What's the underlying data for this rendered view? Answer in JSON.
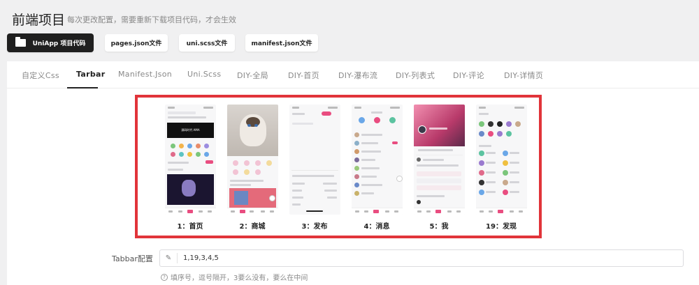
{
  "header": {
    "title": "前端项目",
    "subtitle": "每次更改配置，需要重新下载项目代码，才会生效"
  },
  "toolbar": {
    "buttons": [
      {
        "label": "UniApp 项目代码",
        "icon": "folder-icon",
        "style": "primary"
      },
      {
        "label": "pages.json文件"
      },
      {
        "label": "uni.scss文件"
      },
      {
        "label": "manifest.json文件"
      }
    ]
  },
  "tabs": {
    "active_index": 1,
    "items": [
      {
        "label": "自定义Css"
      },
      {
        "label": "Tarbar"
      },
      {
        "label": "Manifest.Json"
      },
      {
        "label": "Uni.Scss"
      },
      {
        "label": "DIY-全局"
      },
      {
        "label": "DIY-首页"
      },
      {
        "label": "DIY-瀑布流"
      },
      {
        "label": "DIY-列表式"
      },
      {
        "label": "DIY-评论"
      },
      {
        "label": "DIY-详情页"
      }
    ]
  },
  "preview": {
    "border_color": "#e1343a",
    "screens": [
      {
        "label": "1：首页",
        "banner_text": "源码时代 AMA"
      },
      {
        "label": "2：商城"
      },
      {
        "label": "3：发布"
      },
      {
        "label": "4：消息"
      },
      {
        "label": "5：我"
      },
      {
        "label": "19：发现"
      }
    ]
  },
  "form": {
    "label": "Tabbar配置",
    "value": "1,19,3,4,5",
    "help": "填序号，逗号隔开，3要么没有，要么在中间",
    "pencil_icon": "pencil-icon",
    "help_icon": "question-circle-icon"
  },
  "colors": {
    "primary_button": "#1f1f1f",
    "accent_pink": "#e94d80",
    "page_bg": "#f0f0f1"
  }
}
